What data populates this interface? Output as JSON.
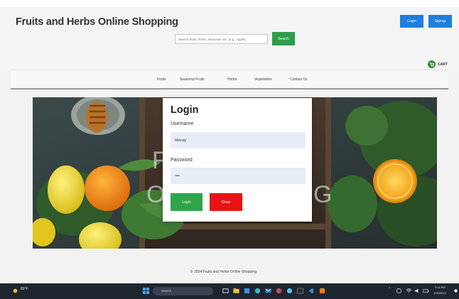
{
  "fragment_heading": "",
  "header": {
    "site_title": "Fruits and Herbs Online Shopping",
    "login_label": "Login",
    "signup_label": "Signup",
    "search_placeholder": "Search fruits, herbs, seasonal, etc. (e.g., Apple)",
    "search_button_label": "Search",
    "cart_label": "CART"
  },
  "nav": {
    "items": [
      "Fruits",
      "Seasonal Fruits",
      "Herbs",
      "Vegetables",
      "Contact Us"
    ]
  },
  "hero": {
    "overlay_lines": [
      "FR",
      "O",
      "G"
    ]
  },
  "login_modal": {
    "title": "Login",
    "username_label": "Username",
    "username_value": "Melody",
    "password_label": "Password",
    "password_value": "••••",
    "login_button": "Login",
    "close_button": "Close"
  },
  "footer": {
    "text": "© 2024 Fruits and Herbs Online Shopping"
  },
  "taskbar": {
    "weather_temp": "89°F",
    "search_label": "Search",
    "time": "3:11 PM",
    "date": "1/26/2024"
  },
  "colors": {
    "primary_blue": "#1e7fe0",
    "search_green": "#2e9e4a",
    "login_green": "#2ea54a",
    "close_red": "#e81414",
    "input_bg": "#e8eef8",
    "taskbar": "#1f2630"
  }
}
